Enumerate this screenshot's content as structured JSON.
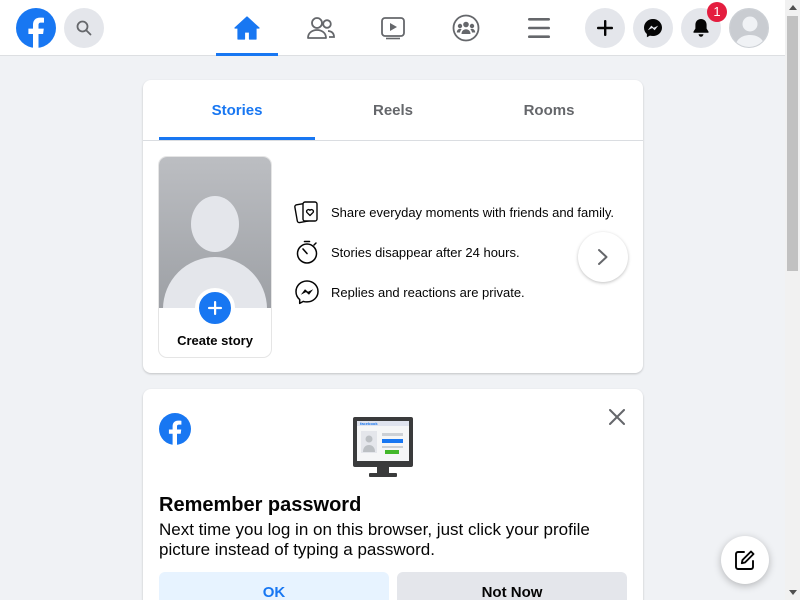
{
  "brand": {
    "color": "#1877f2",
    "logo_icon": "facebook-logo"
  },
  "header": {
    "nav": [
      {
        "name": "home",
        "icon": "home-icon",
        "active": true
      },
      {
        "name": "friends",
        "icon": "friends-icon",
        "active": false
      },
      {
        "name": "watch",
        "icon": "video-icon",
        "active": false
      },
      {
        "name": "groups",
        "icon": "groups-icon",
        "active": false
      },
      {
        "name": "menu",
        "icon": "menu-icon",
        "active": false
      }
    ],
    "notification_count": "1"
  },
  "stories": {
    "tabs": [
      {
        "label": "Stories",
        "active": true
      },
      {
        "label": "Reels",
        "active": false
      },
      {
        "label": "Rooms",
        "active": false
      }
    ],
    "create_label": "Create story",
    "info": [
      {
        "icon": "stories-heart-icon",
        "text": "Share everyday moments with friends and family."
      },
      {
        "icon": "timer-icon",
        "text": "Stories disappear after 24 hours."
      },
      {
        "icon": "messenger-icon",
        "text": "Replies and reactions are private."
      }
    ]
  },
  "remember_password": {
    "illustration_text": "facebook",
    "title": "Remember password",
    "text": "Next time you log in on this browser, just click your profile picture instead of typing a password.",
    "ok_label": "OK",
    "not_now_label": "Not Now"
  }
}
